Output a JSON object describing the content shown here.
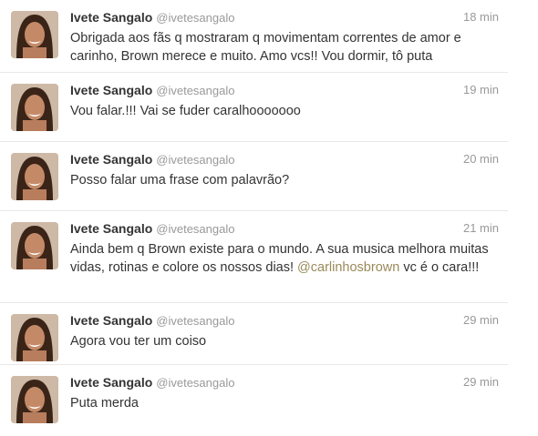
{
  "tweets": [
    {
      "name": "Ivete Sangalo",
      "handle": "@ivetesangalo",
      "time": "18 min",
      "text": "Obrigada aos fãs q mostraram q movimentam correntes de amor e carinho, Brown merece e muito. Amo vcs!! Vou dormir, tô puta"
    },
    {
      "name": "Ivete Sangalo",
      "handle": "@ivetesangalo",
      "time": "19 min",
      "text": "Vou falar.!!! Vai se fuder caralhooooooo"
    },
    {
      "name": "Ivete Sangalo",
      "handle": "@ivetesangalo",
      "time": "20 min",
      "text": "Posso falar uma frase com palavrão?"
    },
    {
      "name": "Ivete Sangalo",
      "handle": "@ivetesangalo",
      "time": "21 min",
      "text_before": "Ainda bem q Brown existe para o mundo. A sua musica melhora muitas vidas, rotinas e colore os nossos dias! ",
      "mention": "@carlinhosbrown",
      "text_after": " vc é o cara!!!"
    },
    {
      "name": "Ivete Sangalo",
      "handle": "@ivetesangalo",
      "time": "29 min",
      "text": "Agora vou ter um coiso"
    },
    {
      "name": "Ivete Sangalo",
      "handle": "@ivetesangalo",
      "time": "29 min",
      "text": "Puta merda"
    }
  ],
  "colors": {
    "name": "#333333",
    "meta": "#999999",
    "mention": "#9a8a5a",
    "divider": "#e8e8e8"
  },
  "icons": {
    "avatar": "profile-photo"
  }
}
